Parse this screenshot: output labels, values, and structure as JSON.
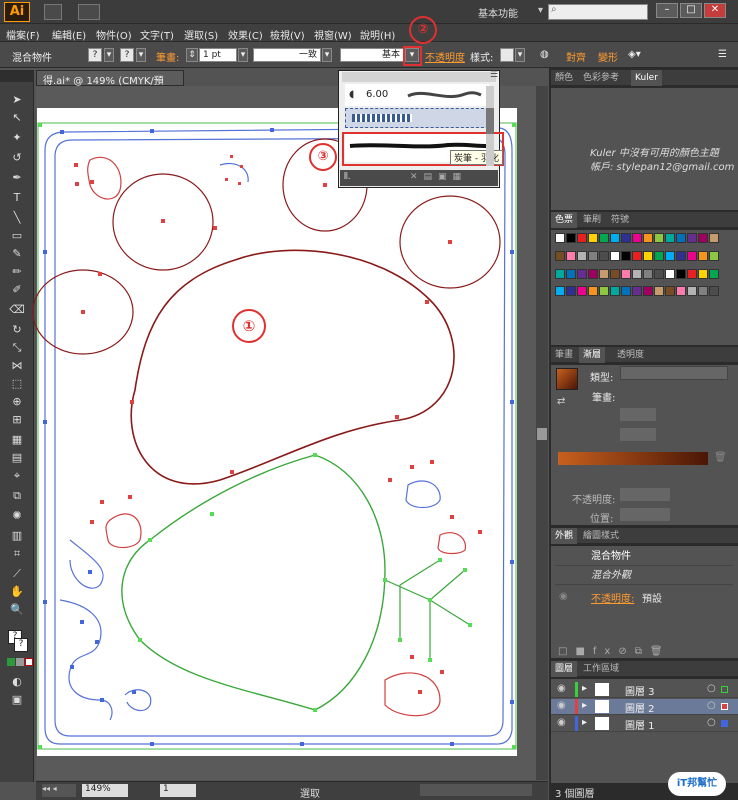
{
  "app": {
    "logo": "Ai",
    "workspace": "基本功能",
    "search_placeholder": ""
  },
  "menu": [
    "檔案(F)",
    "編輯(E)",
    "物件(O)",
    "文字(T)",
    "選取(S)",
    "效果(C)",
    "檢視(V)",
    "視窗(W)",
    "說明(H)"
  ],
  "control": {
    "object_type": "混合物件",
    "stroke_label": "筆畫:",
    "stroke_weight": "1 pt",
    "profile": "一致",
    "brush": "基本",
    "opacity": "不透明度",
    "style": "樣式:",
    "align": "對齊",
    "transform": "變形"
  },
  "document": {
    "tab": "得.ai* @ 149% (CMYK/預視)"
  },
  "brush_popup": {
    "size": "6.00",
    "tooltip": "炭筆 - 羽化"
  },
  "callouts": [
    "①",
    "②",
    "③"
  ],
  "kuler": {
    "tabs": [
      "顏色",
      "色彩參考",
      "Kuler"
    ],
    "message": "Kuler 中沒有可用的顏色主題",
    "account": "帳戶: stylepan12@gmail.com"
  },
  "swatches_panel": {
    "tabs": [
      "色票",
      "筆刷",
      "符號"
    ]
  },
  "gradient": {
    "tabs": [
      "筆畫",
      "漸層",
      "透明度"
    ],
    "type_label": "類型:",
    "stroke_label": "筆畫:",
    "opacity_label": "不透明度:",
    "position_label": "位置:"
  },
  "appearance": {
    "tabs": [
      "外觀",
      "繪圖樣式"
    ],
    "title": "混合物件",
    "item": "混合外觀",
    "opacity": "不透明度:",
    "opacity_value": "預設"
  },
  "layers": {
    "tabs": [
      "圖層",
      "工作區域"
    ],
    "items": [
      "圖層 3",
      "圖層 2",
      "圖層 1"
    ],
    "count": "3 個圖層"
  },
  "status": {
    "zoom": "149%",
    "page": "1",
    "mode": "選取"
  },
  "watermark": "iT邦幫忙"
}
